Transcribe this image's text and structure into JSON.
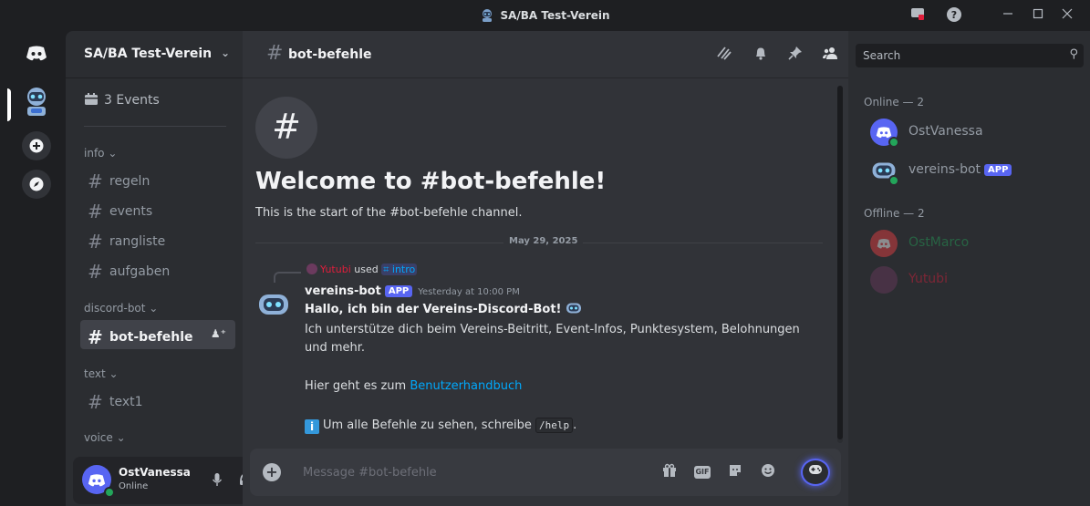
{
  "window": {
    "title": "SA/BA Test-Verein"
  },
  "server": {
    "name": "SA/BA Test-Verein",
    "events_label": "3 Events"
  },
  "categories": [
    {
      "label": "info ⌄"
    },
    {
      "label": "discord-bot ⌄"
    },
    {
      "label": "text ⌄"
    },
    {
      "label": "voice ⌄"
    }
  ],
  "channels": [
    {
      "label": "regeln"
    },
    {
      "label": "events"
    },
    {
      "label": "rangliste"
    },
    {
      "label": "aufgaben"
    },
    {
      "label": "bot-befehle"
    },
    {
      "label": "text1"
    }
  ],
  "user": {
    "name": "OstVanessa",
    "status": "Online"
  },
  "channel": {
    "name": "bot-befehle",
    "welcome_title": "Welcome to #bot-befehle!",
    "welcome_sub": "This is the start of the #bot-befehle channel.",
    "date_divider": "May 29, 2025"
  },
  "message": {
    "reply_user": "Yutubi",
    "reply_used": "used",
    "reply_command": "⌗ intro",
    "author": "vereins-bot",
    "app_tag": "APP",
    "timestamp": "Yesterday at 10:00 PM",
    "line1": "Hallo, ich bin der Vereins-Discord-Bot! ",
    "line2": "Ich unterstütze dich beim Vereins-Beitritt, Event-Infos, Punktesystem, Belohnungen",
    "line3": "und mehr.",
    "line4_prefix": "Hier geht es zum ",
    "line4_link": "Benutzerhandbuch",
    "line5_info": "i",
    "line5_text": "Um alle Befehle zu sehen, schreibe ",
    "line5_code": "/help",
    "line5_end": "."
  },
  "composer": {
    "placeholder": "Message #bot-befehle",
    "gif_label": "GIF"
  },
  "members": {
    "search_placeholder": "Search",
    "online_header": "Online — 2",
    "offline_header": "Offline — 2",
    "online": [
      {
        "name": "OstVanessa",
        "color": "#949ba4"
      },
      {
        "name": "vereins-bot",
        "app_tag": "APP",
        "color": "#949ba4"
      }
    ],
    "offline": [
      {
        "name": "OstMarco",
        "color": "#23a55a"
      },
      {
        "name": "Yutubi",
        "color": "#e01e3c"
      }
    ]
  },
  "colors": {
    "accent": "#5865f2",
    "online": "#23a55a",
    "link": "#00a8fc"
  }
}
